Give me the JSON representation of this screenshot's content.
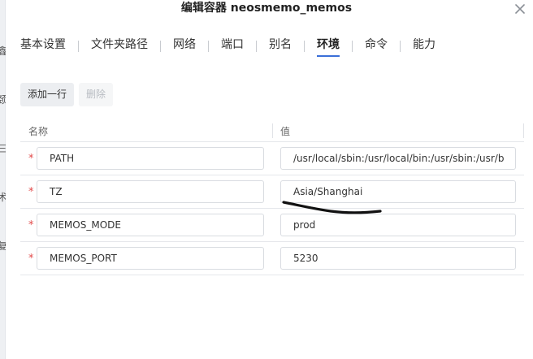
{
  "dialog": {
    "title": "编辑容器 neosmemo_memos"
  },
  "left_strip": {
    "glyphs": [
      "鑫",
      "颈",
      "三",
      "术",
      "复"
    ]
  },
  "tabs": [
    {
      "label": "基本设置",
      "active": false
    },
    {
      "label": "文件夹路径",
      "active": false
    },
    {
      "label": "网络",
      "active": false
    },
    {
      "label": "端口",
      "active": false
    },
    {
      "label": "别名",
      "active": false
    },
    {
      "label": "环境",
      "active": true
    },
    {
      "label": "命令",
      "active": false
    },
    {
      "label": "能力",
      "active": false
    }
  ],
  "toolbar": {
    "add_label": "添加一行",
    "delete_label": "删除"
  },
  "table": {
    "headers": {
      "name": "名称",
      "value": "值"
    },
    "rows": [
      {
        "required": "*",
        "name": "PATH",
        "value": "/usr/local/sbin:/usr/local/bin:/usr/sbin:/usr/b"
      },
      {
        "required": "*",
        "name": "TZ",
        "value": "Asia/Shanghai"
      },
      {
        "required": "*",
        "name": "MEMOS_MODE",
        "value": "prod"
      },
      {
        "required": "*",
        "name": "MEMOS_PORT",
        "value": "5230"
      }
    ]
  },
  "colors": {
    "accent": "#3b6fd8",
    "required": "#e24b4b",
    "annotation_stroke": "#111111"
  },
  "icons": {
    "close": "close-icon"
  }
}
